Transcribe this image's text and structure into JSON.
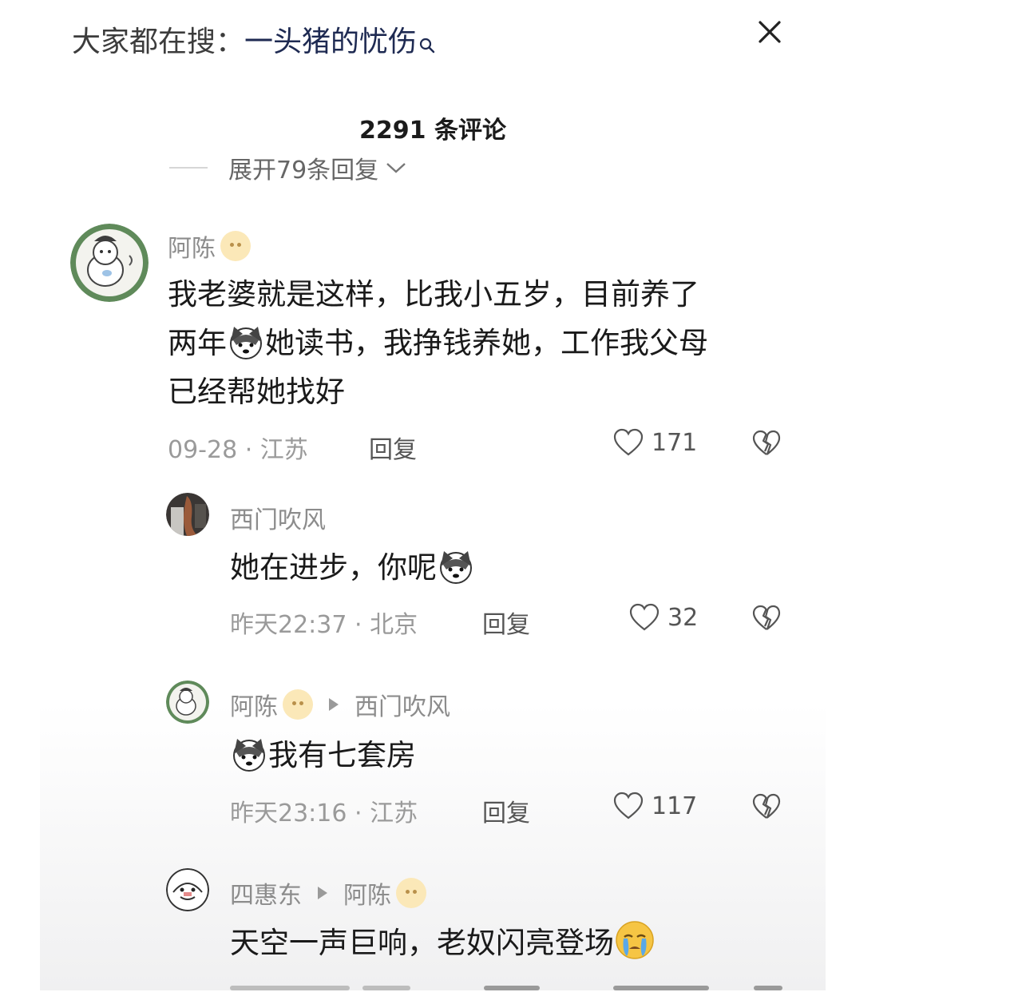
{
  "search_bar": {
    "prefix": "大家都在搜：",
    "term": "一头猪的忧伤"
  },
  "comment_count": "2291 条评论",
  "expand_replies": "展开79条回复",
  "comments": [
    {
      "author": "阿陈",
      "text_lines": [
        "我老婆就是这样，比我小五岁，目前养了",
        "两年",
        "她读书，我挣钱养她，工作我父母",
        "已经帮她找好"
      ],
      "meta": "09-28 · 江苏",
      "reply_label": "回复",
      "likes": "171"
    },
    {
      "author": "西门吹风",
      "text": "她在进步，你呢",
      "meta": "昨天22:37 · 北京",
      "reply_label": "回复",
      "likes": "32"
    },
    {
      "author": "阿陈",
      "reply_to": "西门吹风",
      "text": "我有七套房",
      "meta": "昨天23:16 · 江苏",
      "reply_label": "回复",
      "likes": "117"
    },
    {
      "author": "四惠东",
      "reply_to": "阿陈",
      "text": "天空一声巨响，老奴闪亮登场"
    }
  ]
}
